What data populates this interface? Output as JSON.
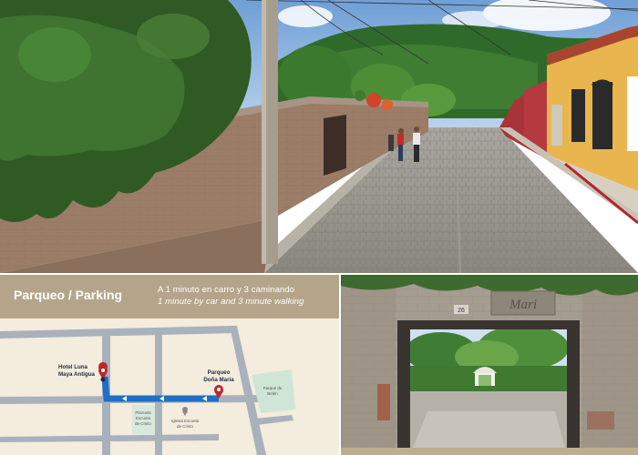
{
  "parking": {
    "title": "Parqueo / Parking",
    "spanish_note": "A 1 minuto en carro y 3 caminando",
    "english_note": "1 minute by car and 3 minute walking",
    "map": {
      "hotel_line1": "Hotel Luna",
      "hotel_line2": "Maya Antigua",
      "parking_line1": "Parqueo",
      "parking_line2": "Doña Maria",
      "plaza_line1": "Plazuela",
      "plaza_line2": "Escuela",
      "plaza_line3": "de Cristo",
      "church_line1": "Iglesia Escuela",
      "church_line2": "de Cristo",
      "park_line1": "Parque de",
      "park_line2": "Belén"
    },
    "colors": {
      "header": "#b4a58a",
      "map_bg": "#f4ecdc",
      "street": "#a9b1bd",
      "route": "#1f6fc4",
      "pin": "#c0262d",
      "park": "#cfe6d6"
    }
  },
  "gate": {
    "number": "26",
    "sign": "Mari"
  }
}
